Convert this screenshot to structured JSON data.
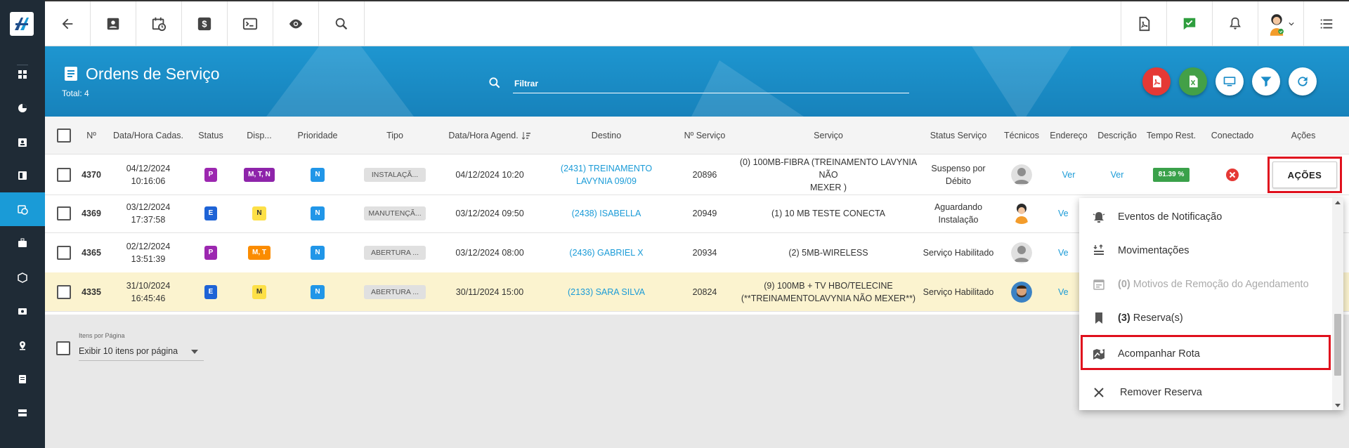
{
  "nav": {
    "items": [
      "dashboard-icon",
      "pie-chart-icon",
      "contact-card-icon",
      "board-icon",
      "calendar-clock-icon",
      "briefcase-icon",
      "box-icon",
      "money-icon",
      "location-pin-icon",
      "list-icon",
      "server-icon"
    ],
    "active_index": 4
  },
  "topbar": {
    "left_icons": [
      "back-arrow-icon",
      "contact-icon",
      "calendar-clock-icon",
      "dollar-icon",
      "terminal-icon",
      "eye-icon",
      "search-icon"
    ],
    "right_icons": [
      "pdf-icon",
      "chat-check-icon",
      "bell-icon",
      "avatar",
      "menu-list-icon"
    ]
  },
  "header": {
    "title": "Ordens de Serviço",
    "total": "Total: 4",
    "search_placeholder": "Filtrar",
    "action_colors": [
      "#e53935",
      "#43a047",
      "#ffffff",
      "#ffffff",
      "#ffffff"
    ]
  },
  "table": {
    "columns": [
      "Nº",
      "Data/Hora Cadas.",
      "Status",
      "Disp...",
      "Prioridade",
      "Tipo",
      "Data/Hora Agend.",
      "Destino",
      "Nº Serviço",
      "Serviço",
      "Status Serviço",
      "Técnicos",
      "Endereço",
      "Descrição",
      "Tempo Rest.",
      "Conectado",
      "Ações"
    ],
    "rows": [
      {
        "num": "4370",
        "cad_date": "04/12/2024",
        "cad_time": "10:16:06",
        "status": "P",
        "status_color": "#9c27b0",
        "disp": "M, T, N",
        "disp_color": "#8e24aa",
        "prio": "N",
        "tipo": "INSTALAÇÃ...",
        "agend": "04/12/2024 10:20",
        "dest1": "(2431) TREINAMENTO",
        "dest2": "LAVYNIA 09/09",
        "nserv": "20896",
        "serv1": "(0) 100MB-FIBRA (TREINAMENTO LAVYNIA NÃO",
        "serv2": "MEXER )",
        "stat1": "Suspenso por",
        "stat2": "Débito",
        "tec": "gray",
        "end": "Ver",
        "desc": "Ver",
        "tempo": "81.39 %",
        "conectado": "x"
      },
      {
        "num": "4369",
        "cad_date": "03/12/2024",
        "cad_time": "17:37:58",
        "status": "E",
        "status_color": "#1e63d6",
        "disp": "N",
        "disp_color": "#fde047",
        "prio": "N",
        "tipo": "MANUTENÇÃ...",
        "agend": "03/12/2024 09:50",
        "dest1": "(2438) ISABELLA",
        "dest2": "",
        "nserv": "20949",
        "serv1": "(1) 10 MB TESTE CONECTA",
        "serv2": "",
        "stat1": "Aguardando",
        "stat2": "Instalação",
        "tec": "woman",
        "end": "Ve",
        "desc": "",
        "tempo": "",
        "conectado": ""
      },
      {
        "num": "4365",
        "cad_date": "02/12/2024",
        "cad_time": "13:51:39",
        "status": "P",
        "status_color": "#9c27b0",
        "disp": "M, T",
        "disp_color": "#fb8c00",
        "prio": "N",
        "tipo": "ABERTURA ...",
        "agend": "03/12/2024 08:00",
        "dest1": "(2436) GABRIEL X",
        "dest2": "",
        "nserv": "20934",
        "serv1": "(2) 5MB-WIRELESS",
        "serv2": "",
        "stat1": "Serviço Habilitado",
        "stat2": "",
        "tec": "gray",
        "end": "Ve",
        "desc": "",
        "tempo": "",
        "conectado": ""
      },
      {
        "num": "4335",
        "cad_date": "31/10/2024",
        "cad_time": "16:45:46",
        "status": "E",
        "status_color": "#1e63d6",
        "disp": "M",
        "disp_color": "#fde047",
        "prio": "N",
        "tipo": "ABERTURA ...",
        "agend": "30/11/2024 15:00",
        "dest1": "(2133) SARA SILVA",
        "dest2": "",
        "nserv": "20824",
        "serv1": "(9) 100MB + TV HBO/TELECINE",
        "serv2": "(**TREINAMENTOLAVYNIA NÃO MEXER**)",
        "stat1": "Serviço Habilitado",
        "stat2": "",
        "tec": "man",
        "end": "Ve",
        "desc": "",
        "tempo": "",
        "conectado": ""
      }
    ]
  },
  "pagination": {
    "label": "Itens por Página",
    "selected": "Exibir 10 itens por página"
  },
  "actions_button": "AÇÕES",
  "dropdown": {
    "items": [
      {
        "icon": "bell-alert-icon",
        "label": "Eventos de Notificação",
        "disabled": false
      },
      {
        "icon": "movements-icon",
        "label": "Movimentações",
        "disabled": false
      },
      {
        "icon": "calendar-icon",
        "count": "(0)",
        "label": "Motivos de Remoção do Agendamento",
        "disabled": true
      },
      {
        "icon": "bookmark-icon",
        "count": "(3)",
        "label": "Reserva(s)",
        "disabled": false
      },
      {
        "icon": "map-route-icon",
        "label": "Acompanhar Rota",
        "disabled": false
      },
      {
        "icon": "close-icon",
        "label": "Remover Reserva",
        "disabled": false
      }
    ]
  }
}
